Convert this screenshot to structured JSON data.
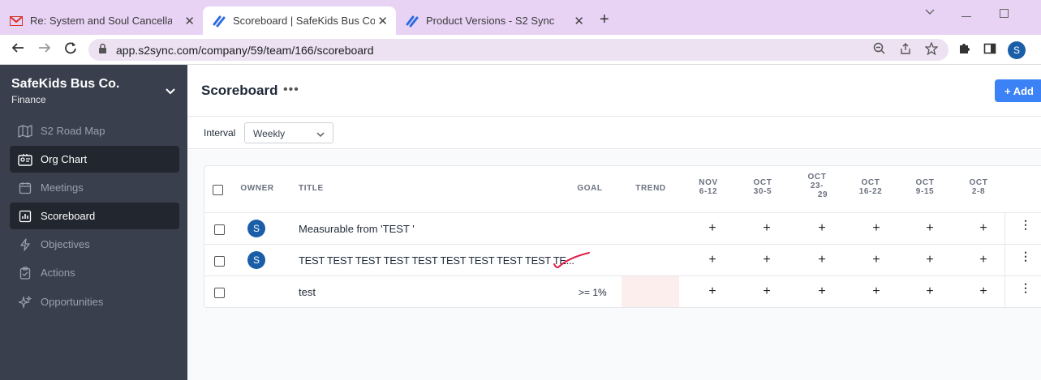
{
  "browser": {
    "tabs": [
      {
        "title": "Re: System and Soul Cancellation",
        "icon": "gmail-icon"
      },
      {
        "title": "Scoreboard | SafeKids Bus Co. | S",
        "icon": "s2sync-icon"
      },
      {
        "title": "Product Versions - S2 Sync",
        "icon": "s2sync-icon"
      }
    ],
    "url": "app.s2sync.com/company/59/team/166/scoreboard",
    "profile_initial": "S"
  },
  "sidebar": {
    "org_name": "SafeKids Bus Co.",
    "team": "Finance",
    "items": [
      {
        "label": "S2 Road Map",
        "icon": "map-icon",
        "active": false
      },
      {
        "label": "Org Chart",
        "icon": "org-chart-icon",
        "active": true
      },
      {
        "label": "Meetings",
        "icon": "calendar-icon",
        "active": false
      },
      {
        "label": "Scoreboard",
        "icon": "bar-chart-icon",
        "active": true
      },
      {
        "label": "Objectives",
        "icon": "bolt-icon",
        "active": false
      },
      {
        "label": "Actions",
        "icon": "clipboard-icon",
        "active": false
      },
      {
        "label": "Opportunities",
        "icon": "sparkle-icon",
        "active": false
      }
    ]
  },
  "header": {
    "title": "Scoreboard",
    "more_label": "•••",
    "add_label": "+ Add"
  },
  "filters": {
    "interval_label": "Interval",
    "interval_value": "Weekly"
  },
  "table": {
    "headers": {
      "owner": "OWNER",
      "title": "TITLE",
      "goal": "GOAL",
      "trend": "TREND"
    },
    "weeks": [
      {
        "line1": "NOV",
        "line2": "6-12",
        "line3": ""
      },
      {
        "line1": "OCT",
        "line2": "30-5",
        "line3": ""
      },
      {
        "line1": "OCT",
        "line2": "23-",
        "line3": "29"
      },
      {
        "line1": "OCT",
        "line2": "16-22",
        "line3": ""
      },
      {
        "line1": "OCT",
        "line2": "9-15",
        "line3": ""
      },
      {
        "line1": "OCT",
        "line2": "2-8",
        "line3": ""
      }
    ],
    "rows": [
      {
        "owner": "S",
        "title": "Measurable from 'TEST '",
        "goal": ""
      },
      {
        "owner": "S",
        "title": "TEST TEST TEST TEST TEST TEST TEST TEST TEST TE...",
        "goal": ""
      },
      {
        "owner": "",
        "title": "test",
        "goal": ">= 1%"
      }
    ],
    "cell_symbol": "+",
    "row_menu": "⋮"
  },
  "colors": {
    "sidebar_bg": "#3a3f4d",
    "accent": "#3b82f6",
    "tab_bar": "#e8d3f5",
    "trend_bad": "#fdeeee",
    "annotation": "#e11d48"
  }
}
